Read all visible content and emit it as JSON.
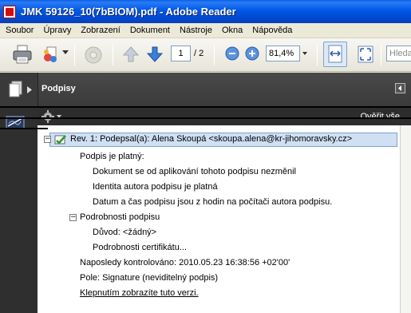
{
  "window": {
    "title": "JMK 59126_10(7bBIOM).pdf - Adobe Reader"
  },
  "menu": [
    "Soubor",
    "Úpravy",
    "Zobrazení",
    "Dokument",
    "Nástroje",
    "Okna",
    "Nápověda"
  ],
  "toolbar": {
    "page_current": "1",
    "page_total": "/ 2",
    "zoom": "81,4%",
    "search_placeholder": "Hleda"
  },
  "panel": {
    "title": "Podpisy",
    "verify_all": "Ověřit vše"
  },
  "signature": {
    "header": "Rev. 1: Podepsal(a): Alena Skoupá <skoupa.alena@kr-jihomoravsky.cz>",
    "valid_label": "Podpis je platný:",
    "valid_items": [
      "Dokument se od aplikování tohoto podpisu nezměnil",
      "Identita autora podpisu je platná",
      "Datum a čas podpisu jsou z hodin na počítači autora podpisu."
    ],
    "details_label": "Podrobnosti podpisu",
    "reason": "Důvod: <žádný>",
    "cert_details": "Podrobnosti certifikátu...",
    "last_checked": "Naposledy kontrolováno: 2010.05.23 16:38:56 +02'00'",
    "field": "Pole: Signature (neviditelný podpis)",
    "view_version_link": "Klepnutím zobrazíte tuto verzi."
  }
}
